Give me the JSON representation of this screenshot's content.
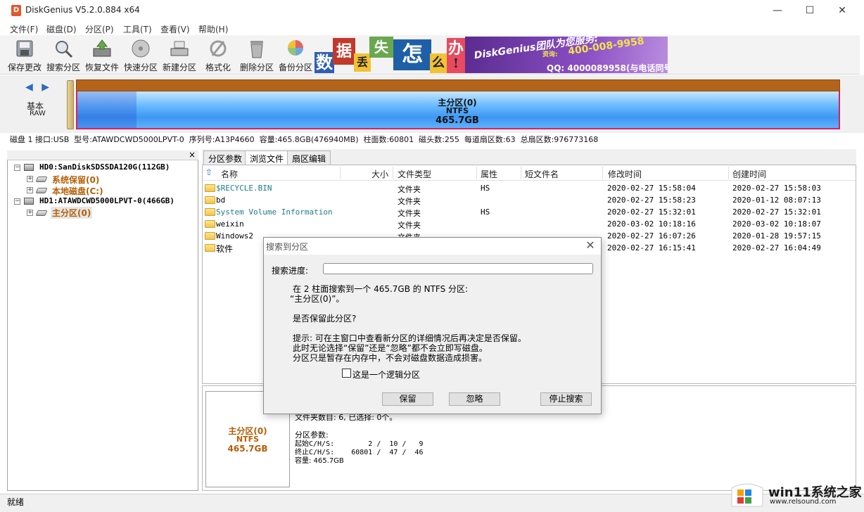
{
  "window": {
    "title": "DiskGenius V5.2.0.884 x64",
    "minimize": "—",
    "maximize": "☐",
    "close": "✕"
  },
  "menu": [
    "文件(F)",
    "磁盘(D)",
    "分区(P)",
    "工具(T)",
    "查看(V)",
    "帮助(H)"
  ],
  "toolbar": [
    {
      "label": "保存更改",
      "icon": "save-icon"
    },
    {
      "label": "搜索分区",
      "icon": "search-icon"
    },
    {
      "label": "恢复文件",
      "icon": "recover-icon"
    },
    {
      "label": "快速分区",
      "icon": "quick-partition-icon"
    },
    {
      "label": "新建分区",
      "icon": "new-partition-icon"
    },
    {
      "label": "格式化",
      "icon": "format-icon"
    },
    {
      "label": "删除分区",
      "icon": "delete-icon"
    },
    {
      "label": "备份分区",
      "icon": "backup-icon"
    }
  ],
  "banner": {
    "tiles": [
      "数",
      "据",
      "丢",
      "失",
      "怎",
      "么",
      "办",
      "!"
    ],
    "team": "DiskGenius团队为您服务:",
    "phone": "400-008-9958",
    "phone_label": "资询:",
    "qq": "QQ: 4000089958(与电话同号)"
  },
  "disk_panel": {
    "nav": "◀ ▶",
    "type": "基本",
    "format": "RAW",
    "partition_name": "主分区(0)",
    "partition_fs": "NTFS",
    "partition_size": "465.7GB"
  },
  "disk_info": "磁盘 1 接口:USB  型号:ATAWDCWD5000LPVT-0  序列号:A13P4660  容量:465.8GB(476940MB)  柱面数:60801  磁头数:255  每道扇区数:63  总扇区数:976773168",
  "tree": {
    "close": "×",
    "nodes": [
      {
        "label": "HD0:SanDiskSDSSDA120G(112GB)",
        "type": "disk"
      },
      {
        "label": "系统保留(0)",
        "type": "partition"
      },
      {
        "label": "本地磁盘(C:)",
        "type": "partition"
      },
      {
        "label": "HD1:ATAWDCWD5000LPVT-0(466GB)",
        "type": "disk"
      },
      {
        "label": "主分区(0)",
        "type": "partition"
      }
    ]
  },
  "tabs": [
    "分区参数",
    "浏览文件",
    "扇区编辑"
  ],
  "columns": [
    "名称",
    "大小",
    "文件类型",
    "属性",
    "短文件名",
    "修改时间",
    "创建时间"
  ],
  "files": [
    {
      "name": "$RECYCLE.BIN",
      "type": "文件夹",
      "attr": "HS",
      "modified": "2020-02-27 15:58:04",
      "created": "2020-02-27 15:58:03"
    },
    {
      "name": "bd",
      "type": "文件夹",
      "attr": "",
      "modified": "2020-02-27 15:58:23",
      "created": "2020-01-12 08:07:13"
    },
    {
      "name": "System Volume Information",
      "type": "文件夹",
      "attr": "HS",
      "modified": "2020-02-27 15:32:01",
      "created": "2020-02-27 15:32:01"
    },
    {
      "name": "weixin",
      "type": "文件夹",
      "attr": "",
      "modified": "2020-03-02 10:18:16",
      "created": "2020-03-02 10:18:07"
    },
    {
      "name": "Windows2",
      "type": "文件夹",
      "attr": "",
      "modified": "2020-02-27 16:07:26",
      "created": "2020-01-28 19:57:15"
    },
    {
      "name": "软件",
      "type": "",
      "attr": "",
      "modified": "2020-02-27 16:15:41",
      "created": "2020-02-27 16:04:49"
    }
  ],
  "details": {
    "name": "主分区(0)",
    "fs": "NTFS",
    "size": "465.7GB",
    "folders_line": "文件夹数目: 6, 已选择: 0个。",
    "params_title": "分区参数:",
    "start": "起始C/H/S:        2 /  10 /   9",
    "end": "终止C/H/S:    60801 /  47 /  46",
    "capacity": "容量: 465.7GB"
  },
  "dialog": {
    "title": "搜索到分区",
    "close": "✕",
    "progress_label": "搜索进度:",
    "msg1": "在 2 柱面搜索到一个 465.7GB 的 NTFS 分区:",
    "msg2": "“主分区(0)”。",
    "question": "是否保留此分区?",
    "hint1": "提示: 可在主窗口中查看新分区的详细情况后再决定是否保留。",
    "hint2": "此时无论选择“保留”还是“忽略”都不会立即写磁盘。",
    "hint3": "分区只是暂存在内存中，不会对磁盘数据造成损害。",
    "checkbox": "这是一个逻辑分区",
    "btn_keep": "保留",
    "btn_ignore": "忽略",
    "btn_stop": "停止搜索"
  },
  "status": "就绪",
  "watermark": {
    "text": "win11系统之家",
    "url": "www.relsound.com"
  }
}
